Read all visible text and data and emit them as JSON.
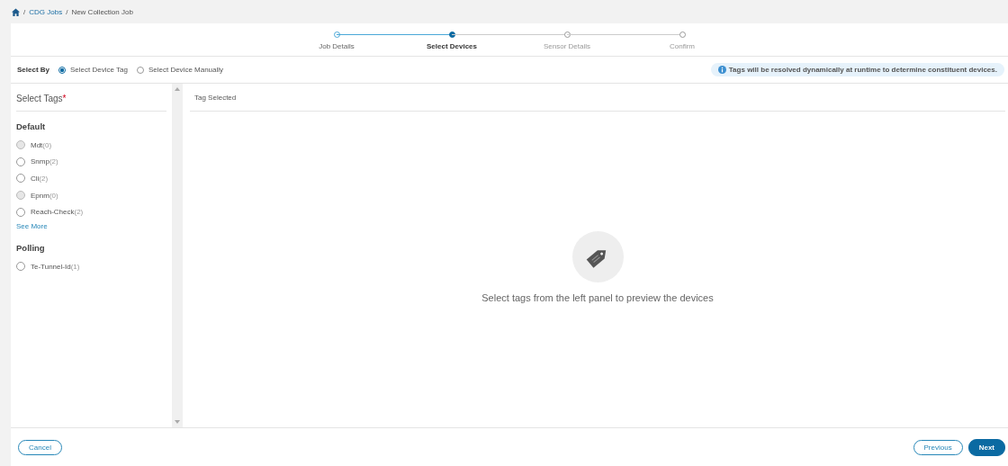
{
  "breadcrumb": [
    {
      "separator": "/",
      "label": "CDG Jobs",
      "link": true
    },
    {
      "separator": "/",
      "label": "New Collection Job",
      "link": false
    }
  ],
  "steps": [
    {
      "label": "Job Details",
      "completed": true,
      "selected": false
    },
    {
      "label": "Select Devices",
      "completed": false,
      "selected": true
    },
    {
      "label": "Sensor Details",
      "completed": false,
      "selected": false
    },
    {
      "label": "Confirm",
      "completed": false,
      "selected": false
    }
  ],
  "select_by": {
    "label": "Select By",
    "options": [
      {
        "label": "Select Device Tag",
        "selected": true
      },
      {
        "label": "Select Device Manually",
        "selected": false
      }
    ]
  },
  "info_banner": "Tags will be resolved dynamically at runtime to determine constituent devices.",
  "tags_panel": {
    "title": "Select Tags",
    "required_mark": "*",
    "groups": [
      {
        "name": "Default",
        "tags": [
          {
            "name": "Mdt",
            "count": "(0)",
            "selected": false,
            "disabled": true
          },
          {
            "name": "Snmp",
            "count": "(2)",
            "selected": false,
            "disabled": false
          },
          {
            "name": "Cli",
            "count": "(2)",
            "selected": false,
            "disabled": false
          },
          {
            "name": "Epnm",
            "count": "(0)",
            "selected": false,
            "disabled": true
          },
          {
            "name": "Reach-Check",
            "count": "(2)",
            "selected": false,
            "disabled": false
          }
        ],
        "see_more": "See More"
      },
      {
        "name": "Polling",
        "tags": [
          {
            "name": "Te-Tunnel-Id",
            "count": "(1)",
            "selected": false,
            "disabled": false
          }
        ]
      }
    ]
  },
  "selected_panel": {
    "title": "Tag Selected",
    "empty_message": "Select tags from the left panel to preview the devices"
  },
  "footer": {
    "cancel": "Cancel",
    "previous": "Previous",
    "next": "Next"
  }
}
